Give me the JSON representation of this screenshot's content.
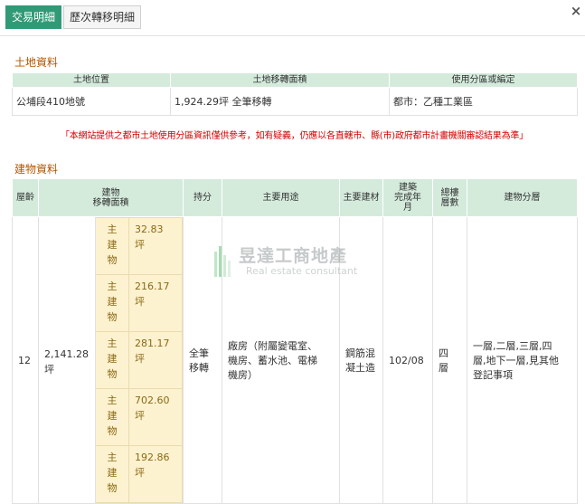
{
  "tabs": [
    {
      "label": "交易明細",
      "active": true
    },
    {
      "label": "歷次轉移明細",
      "active": false
    }
  ],
  "close_glyph": "×",
  "land": {
    "title": "土地資料",
    "headers": [
      "土地位置",
      "土地移轉面積",
      "使用分區或編定"
    ],
    "row": [
      "公埔段410地號",
      "1,924.29坪 全筆移轉",
      "都市：乙種工業區"
    ]
  },
  "notice": "「本網站提供之都市土地使用分區資訊僅供參考，如有疑義，仍應以各直轄市、縣(市)政府都市計畫機關審認結果為準」",
  "building": {
    "title": "建物資料",
    "headers": {
      "age": "屋齡",
      "area": "建物\n移轉面積",
      "share": "持分",
      "use": "主要用途",
      "material": "主要建材",
      "completed": "建築\n完成年\n月",
      "floors": "總樓\n層數",
      "layers": "建物分層"
    },
    "row": {
      "age": "12",
      "area": "2,141.28\n坪",
      "share": "全筆\n移轉",
      "use": "廠房（附屬變電室、\n機房、蓄水池、電梯\n機房）",
      "material": "鋼筋混\n凝土造",
      "completed": "102/08",
      "floors": "四\n層",
      "layers": "一層,二層,三層,四\n層,地下一層,見其他\n登記事項"
    },
    "sub_items": [
      {
        "kind": "主\n建\n物",
        "area": "32.83\n坪"
      },
      {
        "kind": "主\n建\n物",
        "area": "216.17\n坪"
      },
      {
        "kind": "主\n建\n物",
        "area": "281.17\n坪"
      },
      {
        "kind": "主\n建\n物",
        "area": "702.60\n坪"
      },
      {
        "kind": "主\n建\n物",
        "area": "192.86\n坪"
      }
    ]
  },
  "watermark": {
    "title": "昱達工商地產",
    "subtitle": "Real estate consultant"
  },
  "colors": {
    "accent": "#2f9a75",
    "header_bg": "#d4ebdc",
    "section_title": "#b25600",
    "notice": "#d40000",
    "sub_bg": "#fdf2d0"
  }
}
